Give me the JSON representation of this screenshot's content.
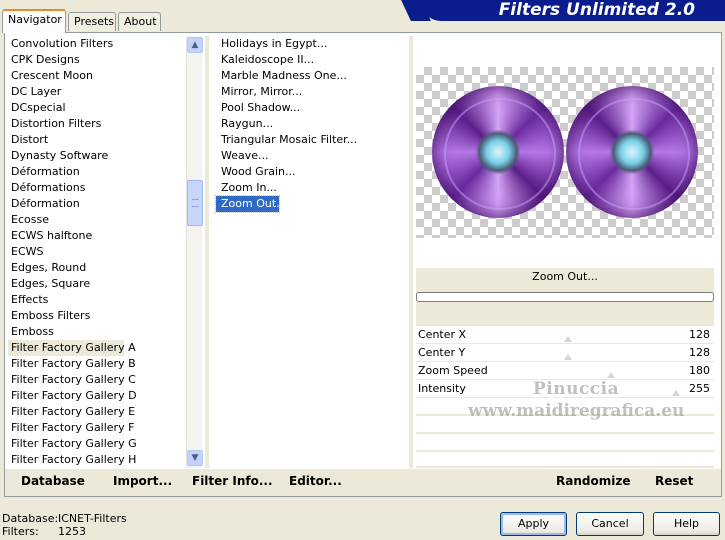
{
  "tabs": [
    {
      "label": "Navigator"
    },
    {
      "label": "Presets"
    },
    {
      "label": "About"
    }
  ],
  "banner_title": "Filters Unlimited 2.0",
  "categories": [
    "Convolution Filters",
    "CPK Designs",
    "Crescent Moon",
    "DC Layer",
    "DCspecial",
    "Distortion Filters",
    "Distort",
    "Dynasty Software",
    "Déformation",
    "Déformations",
    "Déformation",
    "Ecosse",
    "ECWS halftone",
    "ECWS",
    "Edges, Round",
    "Edges, Square",
    "Effects",
    "Emboss Filters",
    "Emboss",
    "Filter Factory Gallery A",
    "Filter Factory Gallery B",
    "Filter Factory Gallery C",
    "Filter Factory Gallery D",
    "Filter Factory Gallery E",
    "Filter Factory Gallery F",
    "Filter Factory Gallery G",
    "Filter Factory Gallery H"
  ],
  "selected_category": "Filter Factory Gallery A",
  "filters": [
    "Holidays in Egypt...",
    "Kaleidoscope II...",
    "Marble Madness One...",
    "Mirror, Mirror...",
    "Pool Shadow...",
    "Raygun...",
    "Triangular Mosaic Filter...",
    "Weave...",
    "Wood Grain...",
    "Zoom In...",
    "Zoom Out..."
  ],
  "selected_filter": "Zoom Out...",
  "preview_filter_name": "Zoom Out...",
  "params": [
    {
      "label": "Center X",
      "value": "128",
      "level": 0.5
    },
    {
      "label": "Center Y",
      "value": "128",
      "level": 0.5
    },
    {
      "label": "Zoom Speed",
      "value": "180",
      "level": 0.7
    },
    {
      "label": "Intensity",
      "value": "255",
      "level": 1.0
    }
  ],
  "watermark": {
    "line1": "Pinuccia",
    "line2": "www.maidiregrafica.eu"
  },
  "toolbar": {
    "database": "Database",
    "import": "Import...",
    "filter_info": "Filter Info...",
    "editor": "Editor...",
    "randomize": "Randomize",
    "reset": "Reset"
  },
  "status": {
    "database_label": "Database:",
    "database_value": "ICNET-Filters",
    "filters_label": "Filters:",
    "filters_value": "1253"
  },
  "buttons": {
    "apply": "Apply",
    "cancel": "Cancel",
    "help": "Help"
  },
  "colors": {
    "banner": "#0a1c8e",
    "selection": "#316ac5",
    "accent_tab": "#e68b2c"
  }
}
